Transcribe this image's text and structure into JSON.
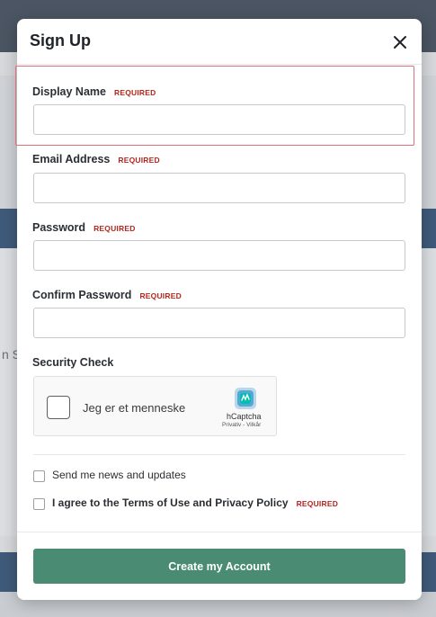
{
  "background": {
    "text": "n Su"
  },
  "modal": {
    "title": "Sign Up",
    "close_icon": "close-icon",
    "required_text": "REQUIRED",
    "fields": {
      "display_name": {
        "label": "Display Name",
        "value": "",
        "placeholder": ""
      },
      "email": {
        "label": "Email Address",
        "value": "",
        "placeholder": ""
      },
      "password": {
        "label": "Password",
        "value": "",
        "placeholder": ""
      },
      "confirm_password": {
        "label": "Confirm Password",
        "value": "",
        "placeholder": ""
      }
    },
    "security": {
      "label": "Security Check",
      "captcha_text": "Jeg er et menneske",
      "brand": "hCaptcha",
      "privacy": "Privativ",
      "sep": " - ",
      "terms": "Vilkår"
    },
    "newsletter": {
      "label": "Send me news and updates",
      "checked": false
    },
    "agree": {
      "prefix": "I agree to the ",
      "terms": "Terms of Use",
      "and": " and ",
      "privacy": "Privacy Policy",
      "checked": false
    },
    "submit_label": "Create my Account"
  },
  "colors": {
    "accent": "#4a8b74",
    "required": "#b3261e",
    "highlight": "#e0707a"
  }
}
